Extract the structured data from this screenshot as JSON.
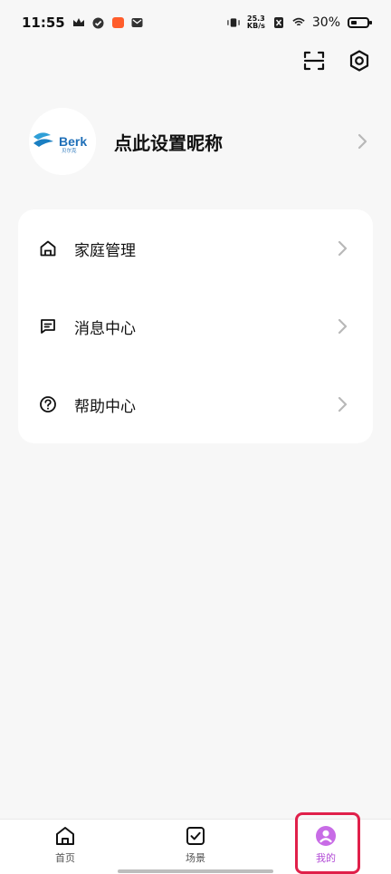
{
  "status_bar": {
    "time": "11:55",
    "net_speed_value": "25.3",
    "net_speed_unit": "KB/s",
    "battery_percent": "30%"
  },
  "profile": {
    "nickname": "点此设置昵称",
    "logo_text": "Berk",
    "logo_subtext": "贝尔克"
  },
  "menu": {
    "items": [
      {
        "label": "家庭管理",
        "icon": "home-icon"
      },
      {
        "label": "消息中心",
        "icon": "message-icon"
      },
      {
        "label": "帮助中心",
        "icon": "help-icon"
      }
    ]
  },
  "bottom_nav": {
    "items": [
      {
        "label": "首页",
        "icon": "home-icon"
      },
      {
        "label": "场景",
        "icon": "checkbox-icon"
      },
      {
        "label": "我的",
        "icon": "profile-icon"
      }
    ],
    "active_index": 2
  },
  "colors": {
    "background": "#f7f7f7",
    "card": "#ffffff",
    "active_tab": "#b24bd6",
    "highlight": "#e0204a"
  }
}
